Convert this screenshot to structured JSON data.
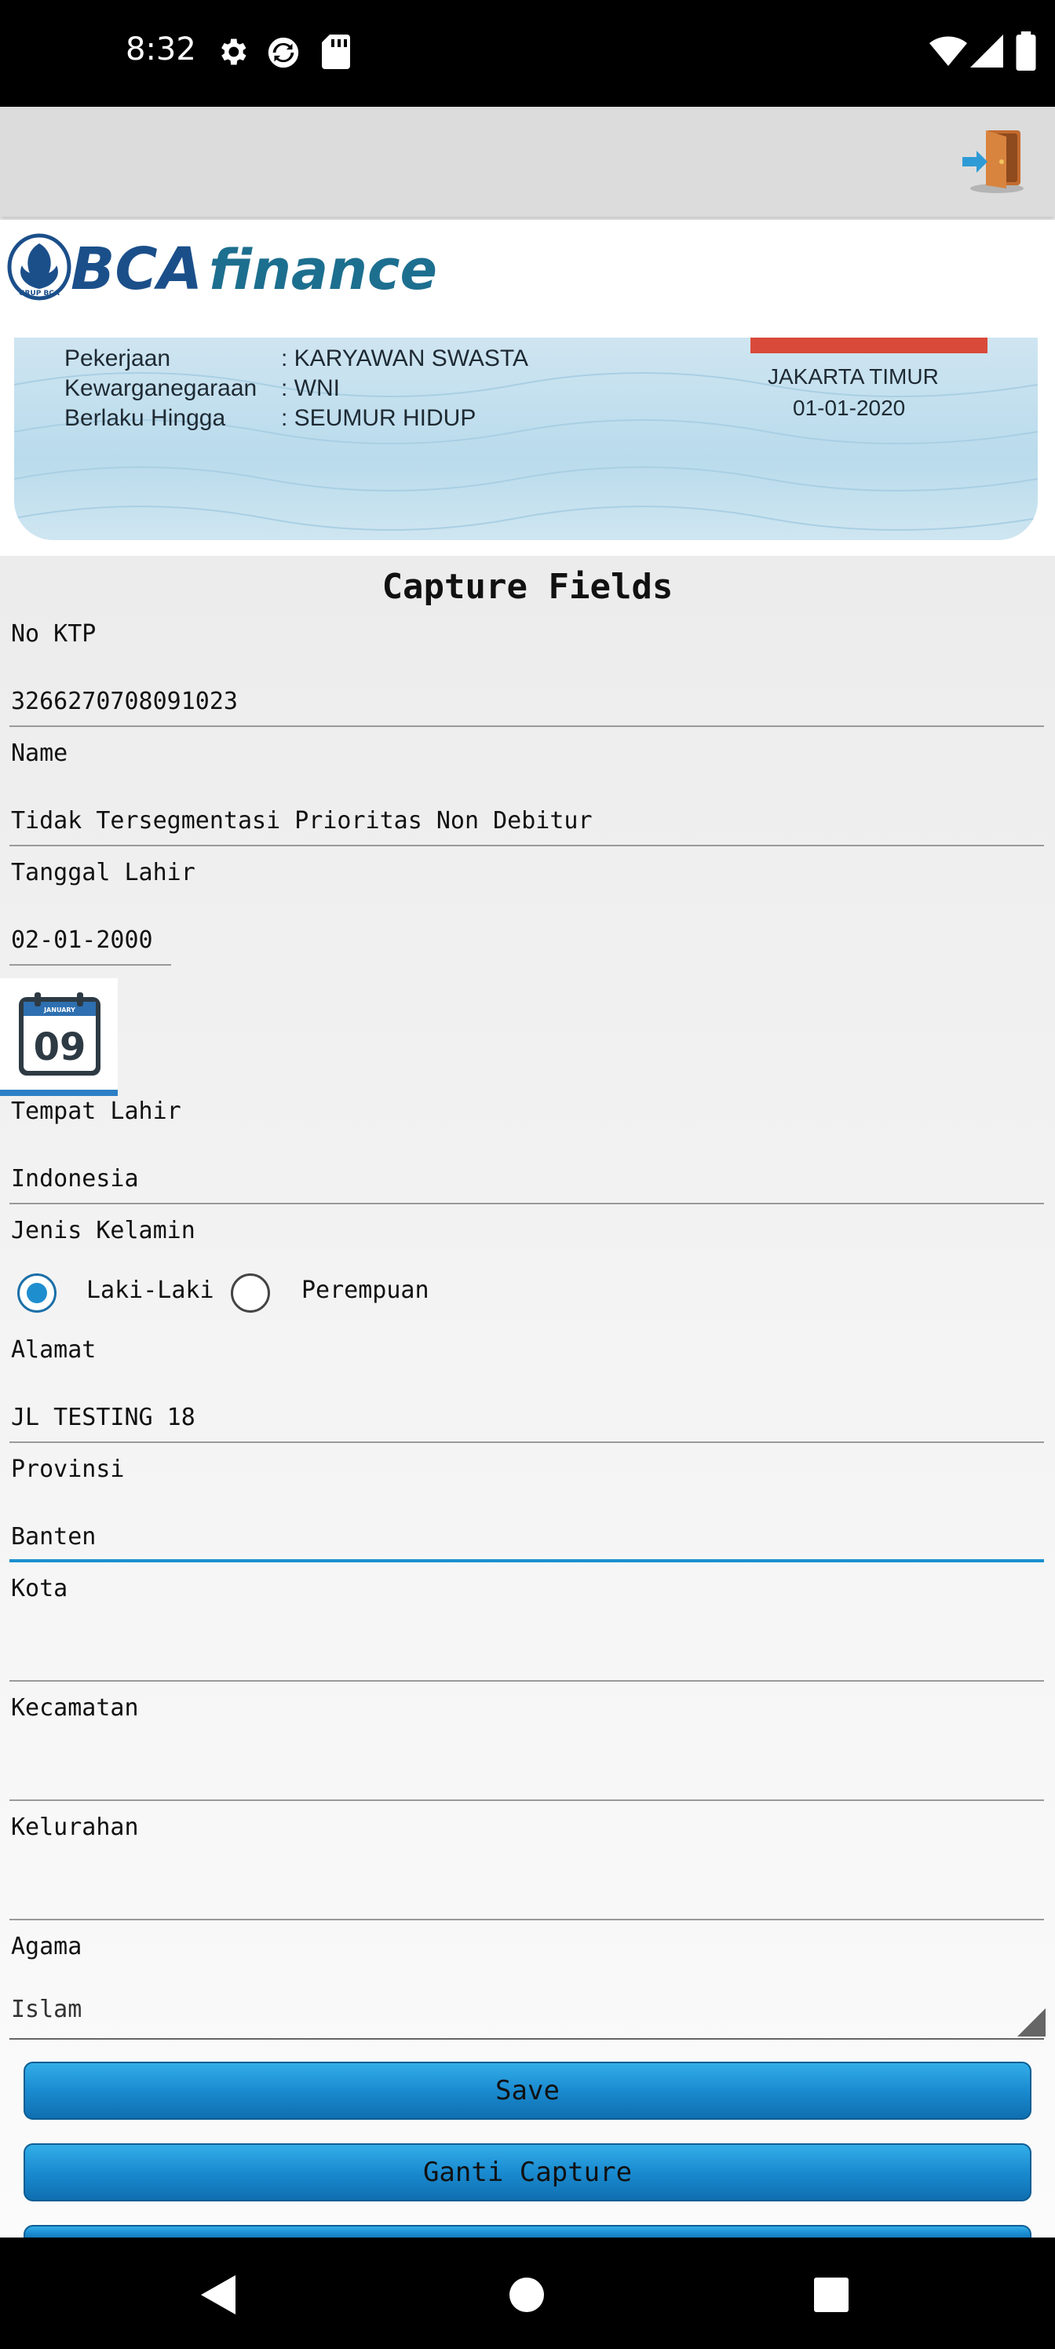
{
  "status_bar": {
    "time": "8:32",
    "icons_left": [
      "gear-icon",
      "sync-icon",
      "sd-card-icon"
    ],
    "icons_right": [
      "wifi-icon",
      "signal-icon",
      "battery-icon"
    ]
  },
  "app_bar": {
    "action_icon": "exit-door-icon"
  },
  "brand": {
    "logo_text_bca": "BCA",
    "logo_text_finance": "finance",
    "logo_small": "GRUP BCA",
    "color_primary": "#1b4f8a",
    "color_secondary": "#1d6f8f"
  },
  "ktp": {
    "rows": [
      {
        "label": "Pekerjaan",
        "value": ": KARYAWAN SWASTA"
      },
      {
        "label": "Kewarganegaraan",
        "value": ": WNI"
      },
      {
        "label": "Berlaku Hingga",
        "value": ": SEUMUR HIDUP"
      }
    ],
    "city": "JAKARTA TIMUR",
    "date": "01-01-2020"
  },
  "form": {
    "title": "Capture Fields",
    "fields": {
      "no_ktp": {
        "label": "No KTP",
        "value": "3266270708091023"
      },
      "name": {
        "label": "Name",
        "value": "Tidak Tersegmentasi Prioritas Non Debitur"
      },
      "tanggal_lahir": {
        "label": "Tanggal Lahir",
        "value": "02-01-2000"
      },
      "tempat_lahir": {
        "label": "Tempat Lahir",
        "value": "Indonesia"
      },
      "jenis_kelamin": {
        "label": "Jenis Kelamin",
        "option_male": "Laki-Laki",
        "option_female": "Perempuan",
        "selected": "Laki-Laki"
      },
      "alamat": {
        "label": "Alamat",
        "value": "JL TESTING 18"
      },
      "provinsi": {
        "label": "Provinsi",
        "value": "Banten"
      },
      "kota": {
        "label": "Kota",
        "value": ""
      },
      "kecamatan": {
        "label": "Kecamatan",
        "value": ""
      },
      "kelurahan": {
        "label": "Kelurahan",
        "value": ""
      },
      "agama": {
        "label": "Agama",
        "value": "Islam"
      }
    },
    "calendar_icon": {
      "month": "JANUARY",
      "day": "09"
    },
    "buttons": {
      "save": "Save",
      "ganti_capture": "Ganti Capture"
    }
  },
  "nav_bar": {
    "icons": [
      "back-icon",
      "home-icon",
      "recents-icon"
    ]
  }
}
